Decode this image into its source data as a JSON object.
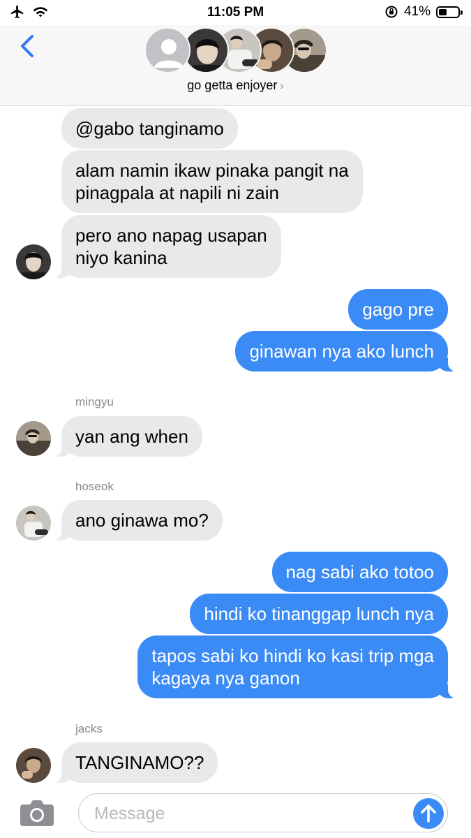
{
  "status_bar": {
    "time": "11:05 PM",
    "battery_text": "41%",
    "battery_level": 0.41,
    "icons": [
      "airplane-icon",
      "wifi-icon",
      "orientation-lock-icon",
      "battery-icon"
    ]
  },
  "header": {
    "group_name": "go getta enjoyer",
    "chevron": "›",
    "avatars": [
      "placeholder-person",
      "member-photo",
      "member-photo",
      "member-photo",
      "member-photo"
    ]
  },
  "messages": [
    {
      "id": "m1",
      "direction": "incoming",
      "text": "@gabo tanginamo"
    },
    {
      "id": "m2",
      "direction": "incoming",
      "lines": [
        "alam namin ikaw pinaka pangit na",
        "pinagpala at napili ni zain"
      ]
    },
    {
      "id": "m3",
      "direction": "incoming",
      "lines": [
        "pero ano napag usapan",
        "niyo kanina"
      ]
    },
    {
      "id": "m4",
      "direction": "outgoing",
      "text": "gago pre"
    },
    {
      "id": "m5",
      "direction": "outgoing",
      "text": "ginawan nya ako lunch"
    },
    {
      "id": "m6",
      "direction": "incoming",
      "sender": "mingyu",
      "text": "yan ang when"
    },
    {
      "id": "m7",
      "direction": "incoming",
      "sender": "hoseok",
      "text": "ano ginawa mo?"
    },
    {
      "id": "m8",
      "direction": "outgoing",
      "text": "nag sabi ako totoo"
    },
    {
      "id": "m9",
      "direction": "outgoing",
      "text": "hindi ko tinanggap lunch nya"
    },
    {
      "id": "m10",
      "direction": "outgoing",
      "lines": [
        "tapos sabi ko hindi ko kasi trip mga",
        "kagaya nya ganon"
      ]
    },
    {
      "id": "m11",
      "direction": "incoming",
      "sender": "jacks",
      "text": "TANGINAMO??"
    }
  ],
  "composer": {
    "placeholder": "Message",
    "value": ""
  },
  "colors": {
    "outgoing_bubble": "#3b8bf6",
    "incoming_bubble": "#e9e9eb",
    "accent": "#3478f6",
    "header_bg": "#f7f7f8"
  }
}
